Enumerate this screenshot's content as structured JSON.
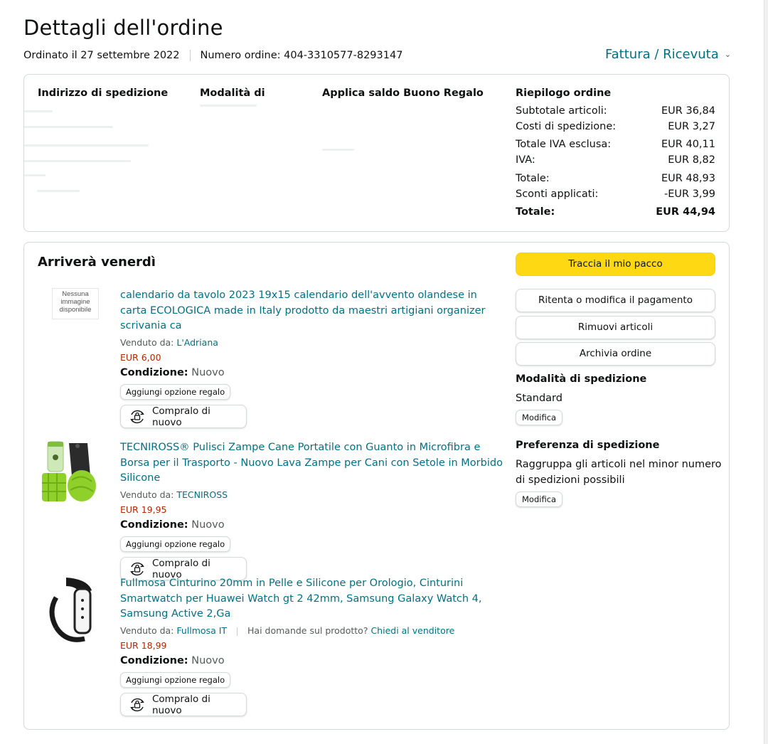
{
  "page": {
    "title": "Dettagli dell'ordine",
    "ordered_on": "Ordinato il 27 settembre 2022",
    "order_number": "Numero ordine: 404-3310577-8293147",
    "invoice_label": "Fattura / Ricevuta",
    "invoice_chevron": "chevron-down-icon"
  },
  "summary": {
    "shipping_address_head": "Indirizzo di spedizione",
    "payment_method_head": "Modalità di",
    "gift_balance_head": "Applica saldo Buono Regalo",
    "order_summary_head": "Riepilogo ordine",
    "rows": [
      {
        "label": "Subtotale articoli:",
        "value": "EUR 36,84",
        "bold": false
      },
      {
        "label": "Costi di spedizione:",
        "value": "EUR 3,27",
        "bold": false
      },
      {
        "label": "Totale IVA esclusa:",
        "value": "EUR 40,11",
        "bold": false
      },
      {
        "label": "IVA:",
        "value": "EUR 8,82",
        "bold": false
      },
      {
        "label": "Totale:",
        "value": "EUR 48,93",
        "bold": false
      },
      {
        "label": "Sconti applicati:",
        "value": "-EUR 3,99",
        "bold": false
      },
      {
        "label": "Totale:",
        "value": "EUR 44,94",
        "bold": true
      }
    ]
  },
  "shipment": {
    "arrival": "Arriverà venerdì",
    "track_button": "Traccia il mio pacco",
    "retry_payment_button": "Ritenta o modifica il pagamento",
    "remove_items_button": "Rimuovi articoli",
    "archive_button": "Archivia ordine",
    "shipping_method_head": "Modalità di spedizione",
    "shipping_method_value": "Standard",
    "shipping_method_edit": "Modifica",
    "shipping_pref_head": "Preferenza di spedizione",
    "shipping_pref_value": "Raggruppa gli articoli nel minor numero di spedizioni possibili",
    "shipping_pref_edit": "Modifica"
  },
  "items": [
    {
      "title": "calendario da tavolo 2023 19x15 calendario dell'avvento olandese in carta ECOLOGICA made in Italy prodotto da maestri artigiani organizer scrivania ca",
      "sold_by_label": "Venduto da:",
      "seller": "L'Adriana",
      "price": "EUR 6,00",
      "condition_label": "Condizione:",
      "condition": "Nuovo",
      "gift_button": "Aggiungi opzione regalo",
      "buy_again_button": "Compralo di nuovo",
      "no_image_text": "Nessuna immagine disponibile"
    },
    {
      "title": "TECNIROSS® Pulisci Zampe Cane Portatile con Guanto in Microfibra e Borsa per il Trasporto - Nuovo Lava Zampe per Cani con Setole in Morbido Silicone",
      "sold_by_label": "Venduto da:",
      "seller": "TECNIROSS",
      "price": "EUR 19,95",
      "condition_label": "Condizione:",
      "condition": "Nuovo",
      "gift_button": "Aggiungi opzione regalo",
      "buy_again_button": "Compralo di nuovo"
    },
    {
      "title": "Fullmosa Cinturino 20mm in Pelle e Silicone per Orologio, Cinturini Smartwatch per Huawei Watch gt 2 42mm, Samsung Galaxy Watch 4, Samsung Active 2,Ga",
      "sold_by_label": "Venduto da:",
      "seller": "Fullmosa IT",
      "question_text": "Hai domande sul prodotto?",
      "question_link": "Chiedi al venditore",
      "price": "EUR 18,99",
      "condition_label": "Condizione:",
      "condition": "Nuovo",
      "gift_button": "Aggiungi opzione regalo",
      "buy_again_button": "Compralo di nuovo"
    }
  ],
  "colors": {
    "link": "#007185",
    "price": "#b12704",
    "primary_button": "#ffd814",
    "border": "#d5d9d9"
  }
}
